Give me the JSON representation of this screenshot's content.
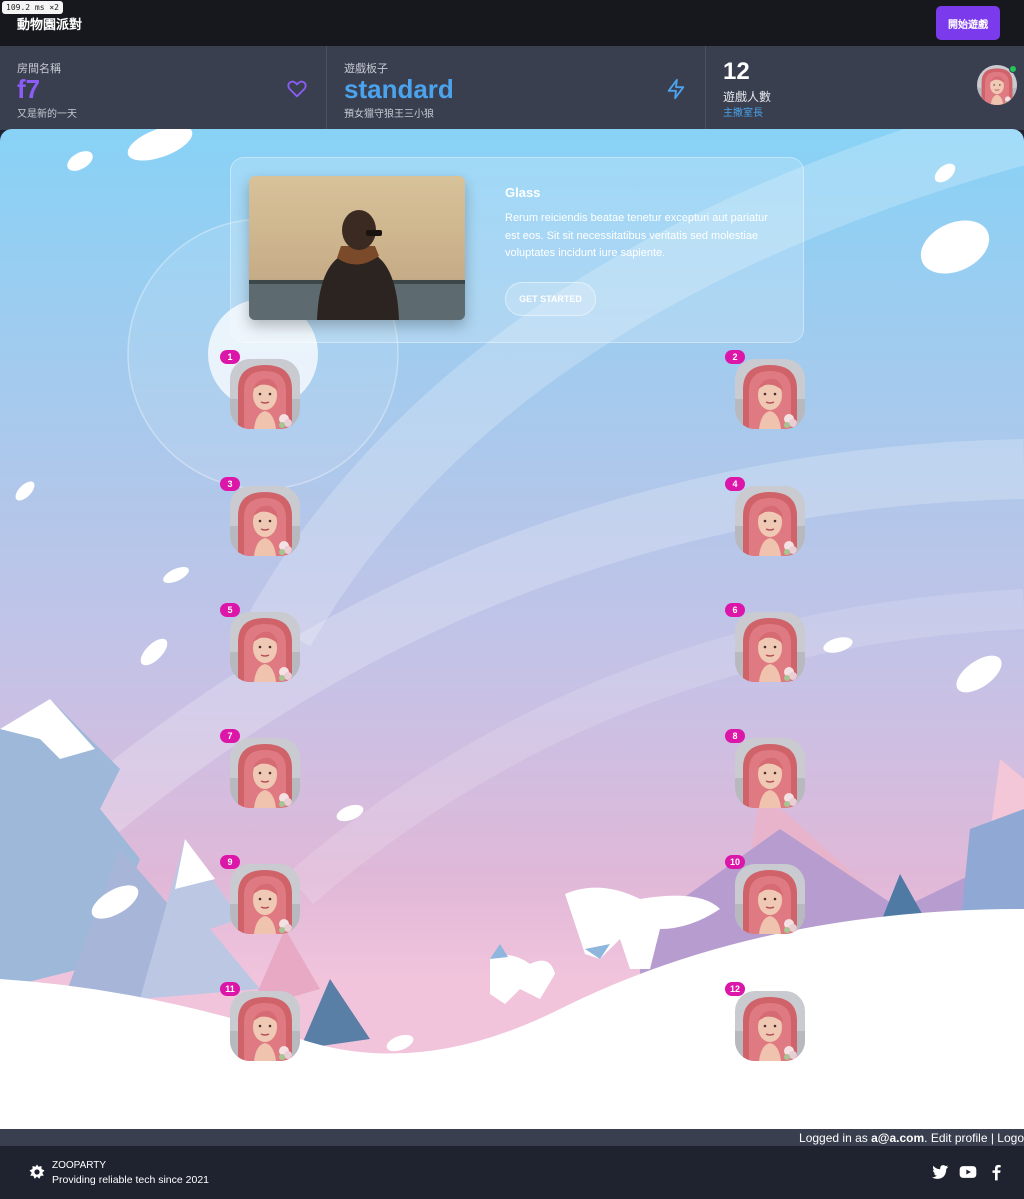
{
  "debug": {
    "perf": "109.2 ms ×2"
  },
  "header": {
    "app_title": "動物園派對",
    "start_button": "開始遊戲"
  },
  "stats": {
    "room": {
      "label": "房間名稱",
      "value": "f7",
      "sub": "又是新的一天",
      "icon": "heart-icon"
    },
    "board": {
      "label": "遊戲板子",
      "value": "standard",
      "sub": "預女獵守狼王三小狼",
      "icon": "lightning-icon"
    },
    "players": {
      "value": "12",
      "label": "遊戲人數",
      "sub": "主撒室長",
      "icon": "avatar-icon"
    }
  },
  "card": {
    "title": "Glass",
    "text": "Rerum reiciendis beatae tenetur excepturi aut pariatur est eos. Sit sit necessitatibus veritatis sed molestiae voluptates incidunt iure sapiente.",
    "button": "GET STARTED"
  },
  "seats": [
    "1",
    "2",
    "3",
    "4",
    "5",
    "6",
    "7",
    "8",
    "9",
    "10",
    "11",
    "12"
  ],
  "login": {
    "prefix": "Logged in as ",
    "email": "a@a.com",
    "suffix": ". Edit profile | Logo"
  },
  "footer": {
    "brand": "ZOOPARTY",
    "tagline": "Providing reliable tech since 2021",
    "social": [
      "twitter-icon",
      "youtube-icon",
      "facebook-icon"
    ]
  },
  "colors": {
    "accent": "#7c3aed",
    "room_value": "#8b5cf6",
    "board_value": "#4aa3ec",
    "badge": "#db16a8",
    "online": "#22c55e"
  }
}
